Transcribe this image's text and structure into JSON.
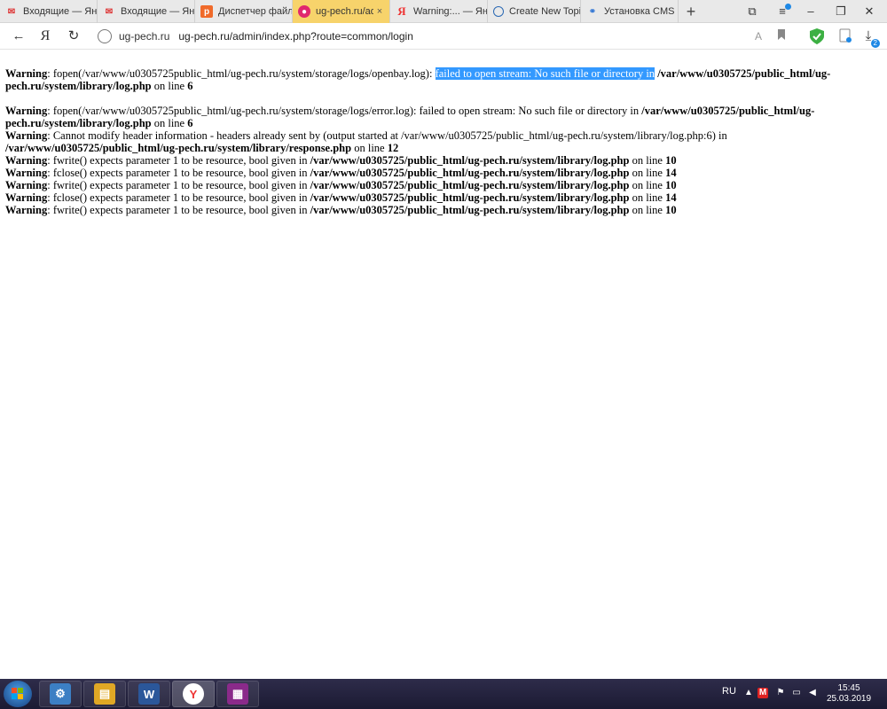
{
  "tabs": [
    {
      "label": "Входящие — Янд",
      "favicon": "gmail-icon",
      "active": false
    },
    {
      "label": "Входящие — Янд",
      "favicon": "gmail-icon",
      "active": false
    },
    {
      "label": "Диспетчер файл",
      "favicon": "filemanager-icon",
      "active": false
    },
    {
      "label": "ug-pech.ru/adi",
      "favicon": "site-icon",
      "active": true,
      "close": "×"
    },
    {
      "label": "Warning:... — Янд",
      "favicon": "yandex-icon",
      "active": false
    },
    {
      "label": "Create New Topic",
      "favicon": "globe-icon",
      "active": false
    },
    {
      "label": "Установка CMS ",
      "favicon": "network-icon",
      "active": false
    }
  ],
  "window_controls": {
    "new_tab": "+",
    "minimize": "–",
    "restore": "❐",
    "close": "✕"
  },
  "navbar": {
    "back": "←",
    "yandex": "Я",
    "reload": "↻",
    "domain": "ug-pech.ru",
    "url": "ug-pech.ru/admin/index.php?route=common/login",
    "download_badge": "2"
  },
  "content": {
    "block1": {
      "warn": "Warning",
      "text1": ": fopen(/var/www/u0305725public_html/ug-pech.ru/system/storage/logs/openbay.log): ",
      "selected": "failed to open stream: No such file or directory in",
      "text2": " ",
      "path": "/var/www/u0305725/public_html/ug-pech.ru/system/library/log.php",
      "online": " on line ",
      "line": "6"
    },
    "block2": [
      {
        "warn": "Warning",
        "text": ": fopen(/var/www/u0305725public_html/ug-pech.ru/system/storage/logs/error.log): failed to open stream: No such file or directory in ",
        "path": "/var/www/u0305725/public_html/ug-pech.ru/system/library/log.php",
        "online": " on line ",
        "line": "6"
      },
      {
        "warn": "Warning",
        "text": ": Cannot modify header information - headers already sent by (output started at /var/www/u0305725/public_html/ug-pech.ru/system/library/log.php:6) in ",
        "path": "/var/www/u0305725/public_html/ug-pech.ru/system/library/response.php",
        "online": " on line ",
        "line": "12"
      },
      {
        "warn": "Warning",
        "text": ": fwrite() expects parameter 1 to be resource, bool given in ",
        "path": "/var/www/u0305725/public_html/ug-pech.ru/system/library/log.php",
        "online": " on line ",
        "line": "10"
      },
      {
        "warn": "Warning",
        "text": ": fclose() expects parameter 1 to be resource, bool given in ",
        "path": "/var/www/u0305725/public_html/ug-pech.ru/system/library/log.php",
        "online": " on line ",
        "line": "14"
      },
      {
        "warn": "Warning",
        "text": ": fwrite() expects parameter 1 to be resource, bool given in ",
        "path": "/var/www/u0305725/public_html/ug-pech.ru/system/library/log.php",
        "online": " on line ",
        "line": "10"
      },
      {
        "warn": "Warning",
        "text": ": fclose() expects parameter 1 to be resource, bool given in ",
        "path": "/var/www/u0305725/public_html/ug-pech.ru/system/library/log.php",
        "online": " on line ",
        "line": "14"
      },
      {
        "warn": "Warning",
        "text": ": fwrite() expects parameter 1 to be resource, bool given in ",
        "path": "/var/www/u0305725/public_html/ug-pech.ru/system/library/log.php",
        "online": " on line ",
        "line": "10"
      }
    ]
  },
  "taskbar": {
    "apps": [
      {
        "name": "control-panel-icon",
        "glyph": "⚙",
        "color": "#3c7fc4"
      },
      {
        "name": "explorer-icon",
        "glyph": "▤",
        "color": "#e0a825"
      },
      {
        "name": "word-icon",
        "glyph": "W",
        "color": "#2b579a"
      },
      {
        "name": "yandex-browser-icon",
        "glyph": "Y",
        "color": "#e33"
      },
      {
        "name": "winrar-icon",
        "glyph": "▦",
        "color": "#8a2a8a"
      }
    ],
    "lang": "RU",
    "time": "15:45",
    "date": "25.03.2019"
  },
  "colors": {
    "selection": "#3399ff",
    "active_tab": "#f7d36b",
    "shield": "#3cb043"
  }
}
